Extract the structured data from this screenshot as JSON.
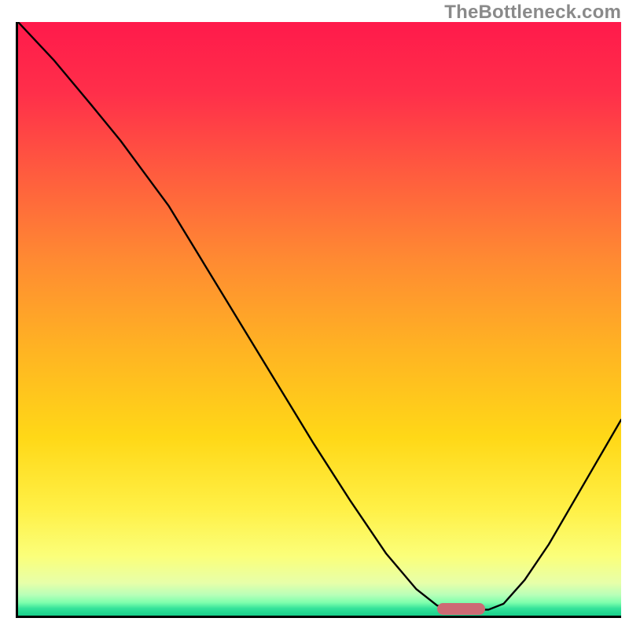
{
  "watermark": "TheBottleneck.com",
  "gradient_stops": [
    {
      "pos": 0.0,
      "color": "#ff1a4b"
    },
    {
      "pos": 0.12,
      "color": "#ff2f4a"
    },
    {
      "pos": 0.25,
      "color": "#ff5a3f"
    },
    {
      "pos": 0.4,
      "color": "#ff8a32"
    },
    {
      "pos": 0.55,
      "color": "#ffb323"
    },
    {
      "pos": 0.7,
      "color": "#ffd817"
    },
    {
      "pos": 0.82,
      "color": "#fff046"
    },
    {
      "pos": 0.9,
      "color": "#fbff7a"
    },
    {
      "pos": 0.945,
      "color": "#e7ffa9"
    },
    {
      "pos": 0.965,
      "color": "#b8ffb8"
    },
    {
      "pos": 0.978,
      "color": "#7fffad"
    },
    {
      "pos": 0.988,
      "color": "#35e29a"
    },
    {
      "pos": 1.0,
      "color": "#17d08b"
    }
  ],
  "marker": {
    "x_frac": 0.732,
    "y_frac": 0.985,
    "w_frac": 0.079,
    "h_frac": 0.02,
    "color": "#cd6a74"
  },
  "chart_data": {
    "type": "line",
    "title": "",
    "xlabel": "",
    "ylabel": "",
    "xlim": [
      0,
      1
    ],
    "ylim": [
      0,
      1
    ],
    "series": [
      {
        "name": "bottleneck-curve",
        "points": [
          {
            "x": 0.0,
            "y": 1.0
          },
          {
            "x": 0.06,
            "y": 0.935
          },
          {
            "x": 0.12,
            "y": 0.862
          },
          {
            "x": 0.17,
            "y": 0.8
          },
          {
            "x": 0.21,
            "y": 0.745
          },
          {
            "x": 0.25,
            "y": 0.69
          },
          {
            "x": 0.31,
            "y": 0.59
          },
          {
            "x": 0.37,
            "y": 0.49
          },
          {
            "x": 0.43,
            "y": 0.39
          },
          {
            "x": 0.49,
            "y": 0.29
          },
          {
            "x": 0.55,
            "y": 0.195
          },
          {
            "x": 0.61,
            "y": 0.105
          },
          {
            "x": 0.66,
            "y": 0.045
          },
          {
            "x": 0.695,
            "y": 0.017
          },
          {
            "x": 0.72,
            "y": 0.01
          },
          {
            "x": 0.78,
            "y": 0.01
          },
          {
            "x": 0.805,
            "y": 0.02
          },
          {
            "x": 0.84,
            "y": 0.06
          },
          {
            "x": 0.88,
            "y": 0.12
          },
          {
            "x": 0.92,
            "y": 0.19
          },
          {
            "x": 0.96,
            "y": 0.26
          },
          {
            "x": 1.0,
            "y": 0.33
          }
        ]
      }
    ],
    "optimal_marker_x": 0.73
  }
}
